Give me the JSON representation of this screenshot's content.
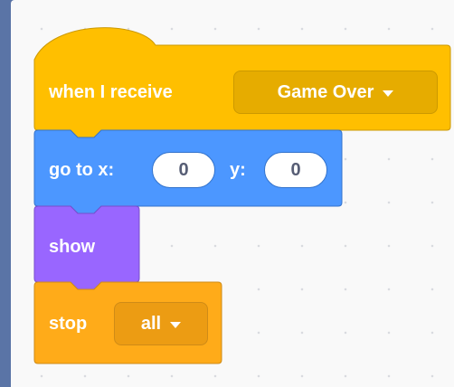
{
  "blocks": {
    "receive": {
      "label": "when I receive",
      "message": "Game Over",
      "color": "#ffbf00",
      "border": "#cc9900",
      "field": "#e6ac00"
    },
    "goto": {
      "label": "go to x:",
      "y_label": "y:",
      "x": "0",
      "y": "0",
      "color": "#4c97ff",
      "border": "#3373cc"
    },
    "show": {
      "label": "show",
      "color": "#9966ff",
      "border": "#774dcb"
    },
    "stop": {
      "label": "stop",
      "option": "all",
      "color": "#ffab19",
      "border": "#cf8b17",
      "field": "#ec9c13"
    }
  },
  "workspace": {
    "background": "#f9f9f9",
    "frame": "#5a74a6"
  }
}
